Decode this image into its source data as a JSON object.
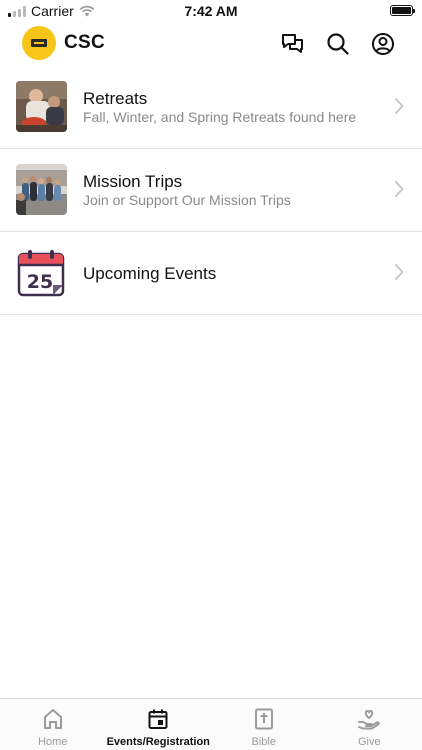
{
  "status_bar": {
    "carrier": "Carrier",
    "time": "7:42 AM"
  },
  "header": {
    "title": "CSC",
    "logo_color": "#f7c517",
    "icons": [
      "chat-icon",
      "search-icon",
      "account-icon"
    ]
  },
  "list": {
    "items": [
      {
        "title": "Retreats",
        "subtitle": "Fall, Winter, and Spring Retreats found here",
        "thumb": "retreats-photo"
      },
      {
        "title": "Mission Trips",
        "subtitle": "Join or Support Our Mission Trips",
        "thumb": "mission-trips-photo"
      },
      {
        "title": "Upcoming Events",
        "subtitle": "",
        "thumb": "calendar-icon",
        "calendar_day": "25"
      }
    ]
  },
  "tabbar": {
    "tabs": [
      {
        "label": "Home",
        "icon": "home-icon",
        "active": false
      },
      {
        "label": "Events/Registration",
        "icon": "calendar-icon",
        "active": true
      },
      {
        "label": "Bible",
        "icon": "bible-icon",
        "active": false
      },
      {
        "label": "Give",
        "icon": "give-icon",
        "active": false
      }
    ]
  }
}
